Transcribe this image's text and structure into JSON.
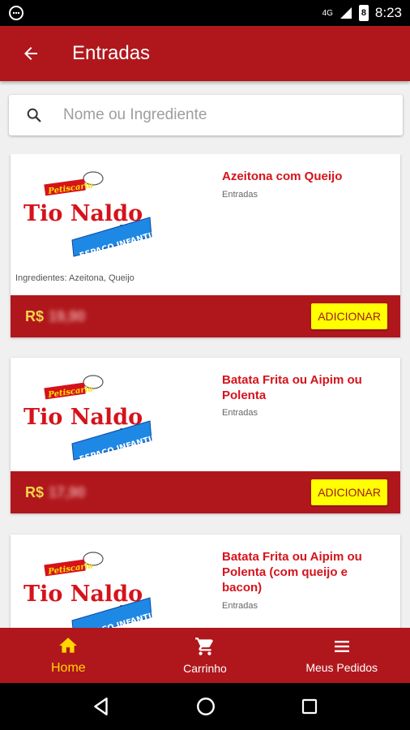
{
  "status_bar": {
    "network": "4G",
    "battery": "8",
    "time": "8:23"
  },
  "app_bar": {
    "title": "Entradas"
  },
  "search": {
    "placeholder": "Nome ou Ingrediente"
  },
  "products": [
    {
      "name": "Azeitona com Queijo",
      "category": "Entradas",
      "ingredients": "Ingredientes: Azeitona, Queijo",
      "currency": "R$",
      "price": "19,90",
      "add_label": "ADICIONAR",
      "logo_text": {
        "top": "Petiscaria",
        "main": "Tio Naldo",
        "com": "com",
        "banner": "ESPAÇO INFANTIL"
      }
    },
    {
      "name": "Batata Frita ou Aipim ou Polenta",
      "category": "Entradas",
      "currency": "R$",
      "price": "17,90",
      "add_label": "ADICIONAR",
      "logo_text": {
        "top": "Petiscaria",
        "main": "Tio Naldo",
        "com": "com",
        "banner": "ESPAÇO INFANTIL"
      }
    },
    {
      "name": "Batata Frita ou Aipim ou Polenta (com queijo e bacon)",
      "category": "Entradas",
      "logo_text": {
        "top": "Petiscaria",
        "main": "Tio Naldo",
        "com": "com",
        "banner": "ESPAÇO INFANTIL"
      }
    }
  ],
  "bottom_nav": [
    {
      "label": "Home",
      "icon": "home-icon",
      "active": true
    },
    {
      "label": "Carrinho",
      "icon": "cart-icon",
      "active": false
    },
    {
      "label": "Meus Pedidos",
      "icon": "list-icon",
      "active": false
    }
  ],
  "colors": {
    "primary": "#b0171c",
    "accent_yellow": "#ffff00",
    "title_red": "#d5131b",
    "active_nav": "#ffd600"
  }
}
